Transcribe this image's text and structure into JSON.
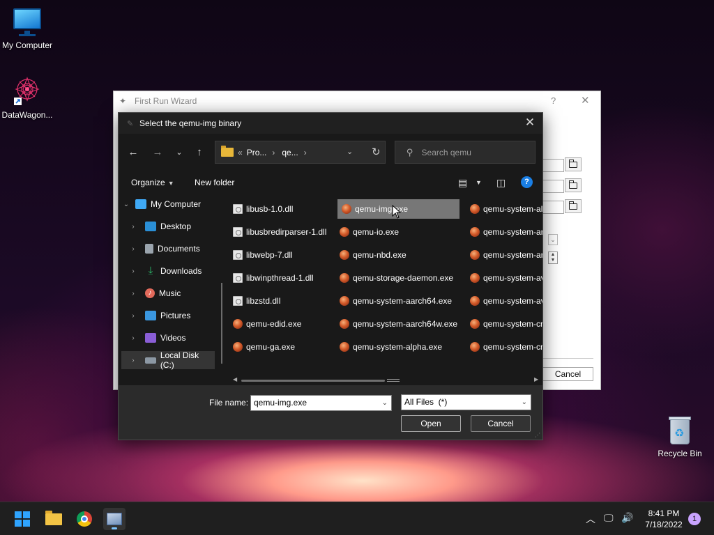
{
  "desktop": {
    "icons": [
      {
        "label": "My Computer",
        "icon": "monitor-icon"
      },
      {
        "label": "DataWagon...",
        "icon": "datawagon-icon"
      },
      {
        "label": "Recycle Bin",
        "icon": "recycle-bin-icon"
      }
    ]
  },
  "wizard": {
    "title": "First Run Wizard",
    "help_glyph": "?",
    "close_glyph": "✕",
    "cancel_label": "Cancel"
  },
  "dialog": {
    "title": "Select the qemu-img binary",
    "close_glyph": "✕",
    "address": {
      "prefix": "«",
      "crumbs": [
        "Pro...",
        "qe..."
      ],
      "separator": "›"
    },
    "search_placeholder": "Search qemu",
    "toolbar": {
      "organize_label": "Organize",
      "new_folder_label": "New folder",
      "help_glyph": "?"
    },
    "sidebar": {
      "items": [
        {
          "label": "My Computer",
          "icon": "computer-icon",
          "color": "#3fa9f5"
        },
        {
          "label": "Desktop",
          "icon": "desktop-icon",
          "color": "#2a8fd6"
        },
        {
          "label": "Documents",
          "icon": "documents-icon",
          "color": "#9aa4ad"
        },
        {
          "label": "Downloads",
          "icon": "downloads-icon",
          "color": "#2dbb6b"
        },
        {
          "label": "Music",
          "icon": "music-icon",
          "color": "#e26a5b"
        },
        {
          "label": "Pictures",
          "icon": "pictures-icon",
          "color": "#3a97e0"
        },
        {
          "label": "Videos",
          "icon": "videos-icon",
          "color": "#8a5ed6"
        },
        {
          "label": "Local Disk (C:)",
          "icon": "drive-icon",
          "color": "#8c98a4"
        }
      ],
      "selected": "Local Disk (C:)"
    },
    "files": {
      "column1": [
        {
          "name": "libusb-1.0.dll",
          "type": "dll"
        },
        {
          "name": "libusbredirparser-1.dll",
          "type": "dll"
        },
        {
          "name": "libwebp-7.dll",
          "type": "dll"
        },
        {
          "name": "libwinpthread-1.dll",
          "type": "dll"
        },
        {
          "name": "libzstd.dll",
          "type": "dll"
        },
        {
          "name": "qemu-edid.exe",
          "type": "exe"
        },
        {
          "name": "qemu-ga.exe",
          "type": "exe"
        }
      ],
      "column2": [
        {
          "name": "qemu-img.exe",
          "type": "exe"
        },
        {
          "name": "qemu-io.exe",
          "type": "exe"
        },
        {
          "name": "qemu-nbd.exe",
          "type": "exe"
        },
        {
          "name": "qemu-storage-daemon.exe",
          "type": "exe"
        },
        {
          "name": "qemu-system-aarch64.exe",
          "type": "exe"
        },
        {
          "name": "qemu-system-aarch64w.exe",
          "type": "exe"
        },
        {
          "name": "qemu-system-alpha.exe",
          "type": "exe"
        }
      ],
      "column3": [
        {
          "name": "qemu-system-al",
          "type": "exe"
        },
        {
          "name": "qemu-system-ar",
          "type": "exe"
        },
        {
          "name": "qemu-system-ar",
          "type": "exe"
        },
        {
          "name": "qemu-system-av",
          "type": "exe"
        },
        {
          "name": "qemu-system-av",
          "type": "exe"
        },
        {
          "name": "qemu-system-cr",
          "type": "exe"
        },
        {
          "name": "qemu-system-cr",
          "type": "exe"
        }
      ],
      "selected": "qemu-img.exe"
    },
    "file_name_label": "File name:",
    "file_name_value": "qemu-img.exe",
    "file_type_value": "All Files  (*)",
    "open_label": "Open",
    "cancel_label": "Cancel"
  },
  "taskbar": {
    "apps": [
      "start-icon",
      "file-explorer-icon",
      "chrome-icon",
      "datawagon-app-icon"
    ],
    "time": "8:41 PM",
    "date": "7/18/2022",
    "notification_count": "1"
  }
}
